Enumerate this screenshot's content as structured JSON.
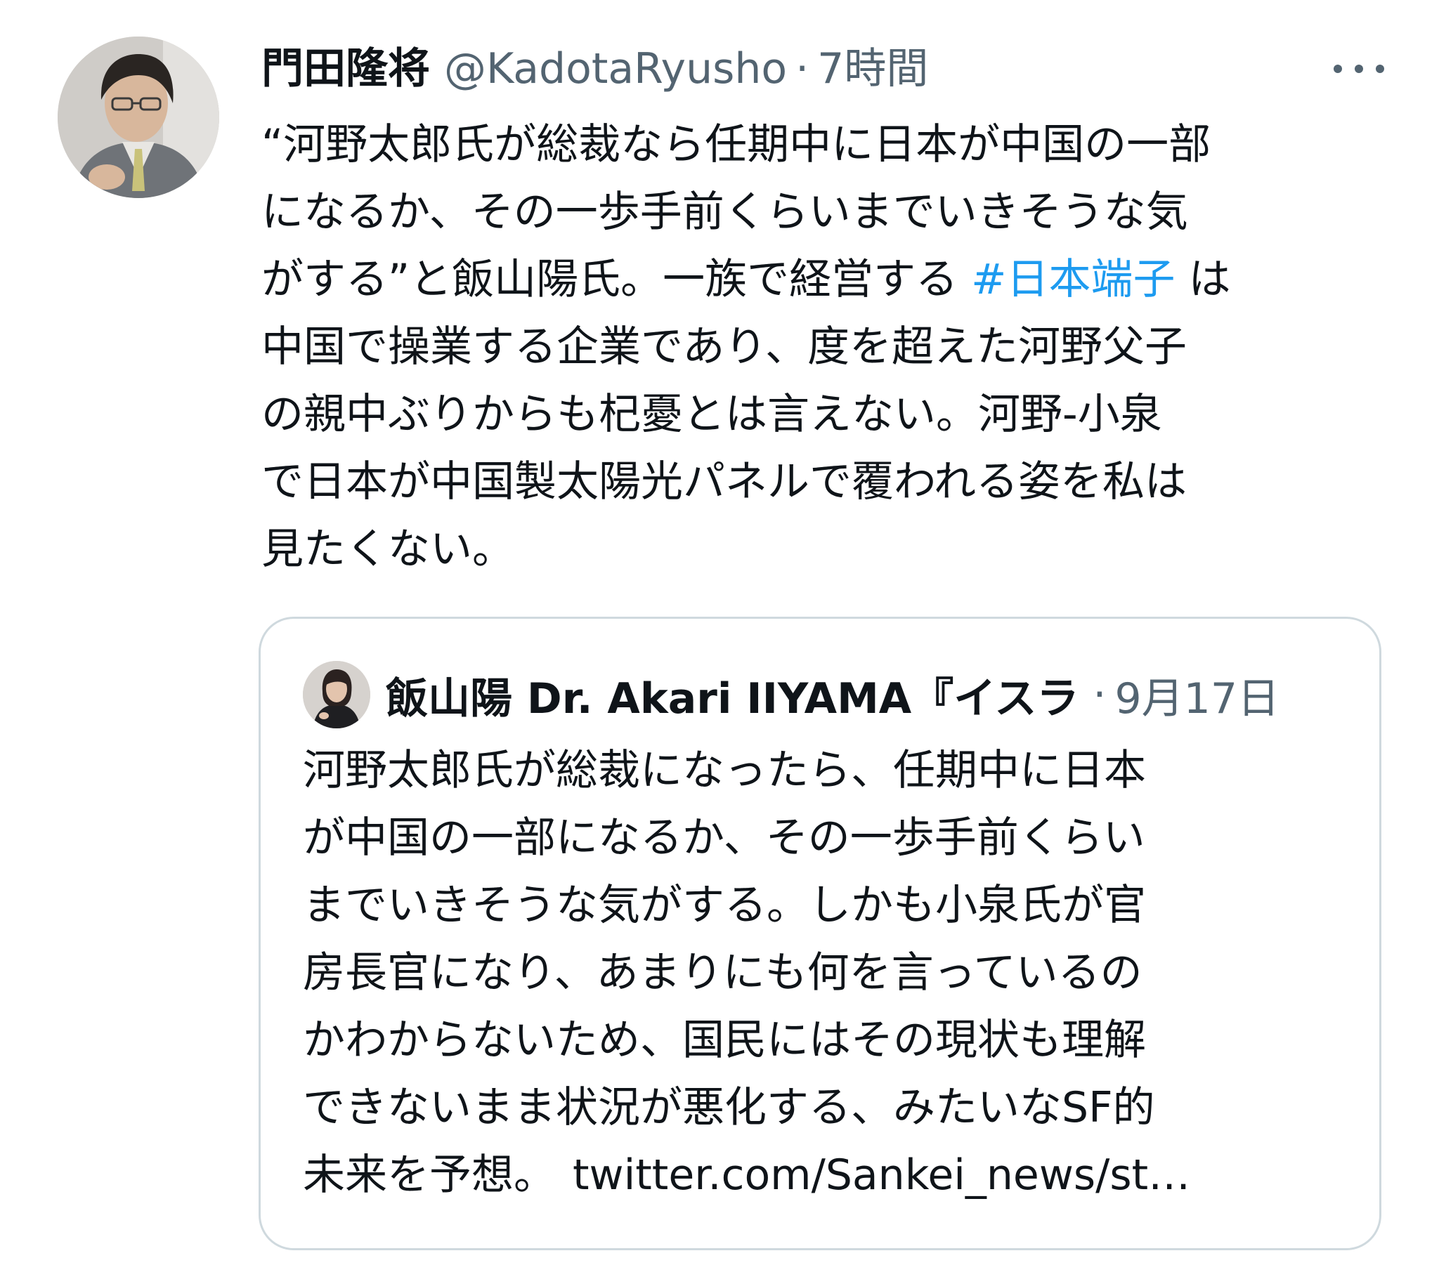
{
  "tweet": {
    "author_name": "門田隆将",
    "author_handle": "@KadotaRyusho",
    "separator": "·",
    "timestamp": "7時間",
    "text_lines": [
      "“河野太郎氏が総裁なら任期中に日本が中国の一部",
      "になるか、その一歩手前くらいまでいきそうな気",
      "がする”と飯山陽氏。一族で経営する",
      "中国で操業する企業であり、度を超えた河野父子",
      "の親中ぶりからも杞憂とは言えない。河野‐小泉",
      "で日本が中国製太陽光パネルで覆われる姿を私は",
      "見たくない。"
    ],
    "hashtag": "#日本端子",
    "after_hashtag": "は"
  },
  "quote": {
    "author_name": "飯山陽 Dr. Akari IIYAMA『イスラ",
    "separator": "·",
    "date": "9月17日",
    "text_lines": [
      "河野太郎氏が総裁になったら、任期中に日本",
      "が中国の一部になるか、その一歩手前くらい",
      "までいきそうな気がする。しかも小泉氏が官",
      "房長官になり、あまりにも何を言っているの",
      "かわからないため、国民にはその現状も理解",
      "できないまま状況が悪化する、みたいなSF的",
      "未来を予想。"
    ],
    "link": "twitter.com/Sankei_news/st…"
  },
  "colors": {
    "text_primary": "#0f1419",
    "text_secondary": "#536471",
    "link_blue": "#1d9bf0",
    "card_border": "#cfd9de"
  },
  "icons": {
    "more": "more-horizontal-icon"
  }
}
